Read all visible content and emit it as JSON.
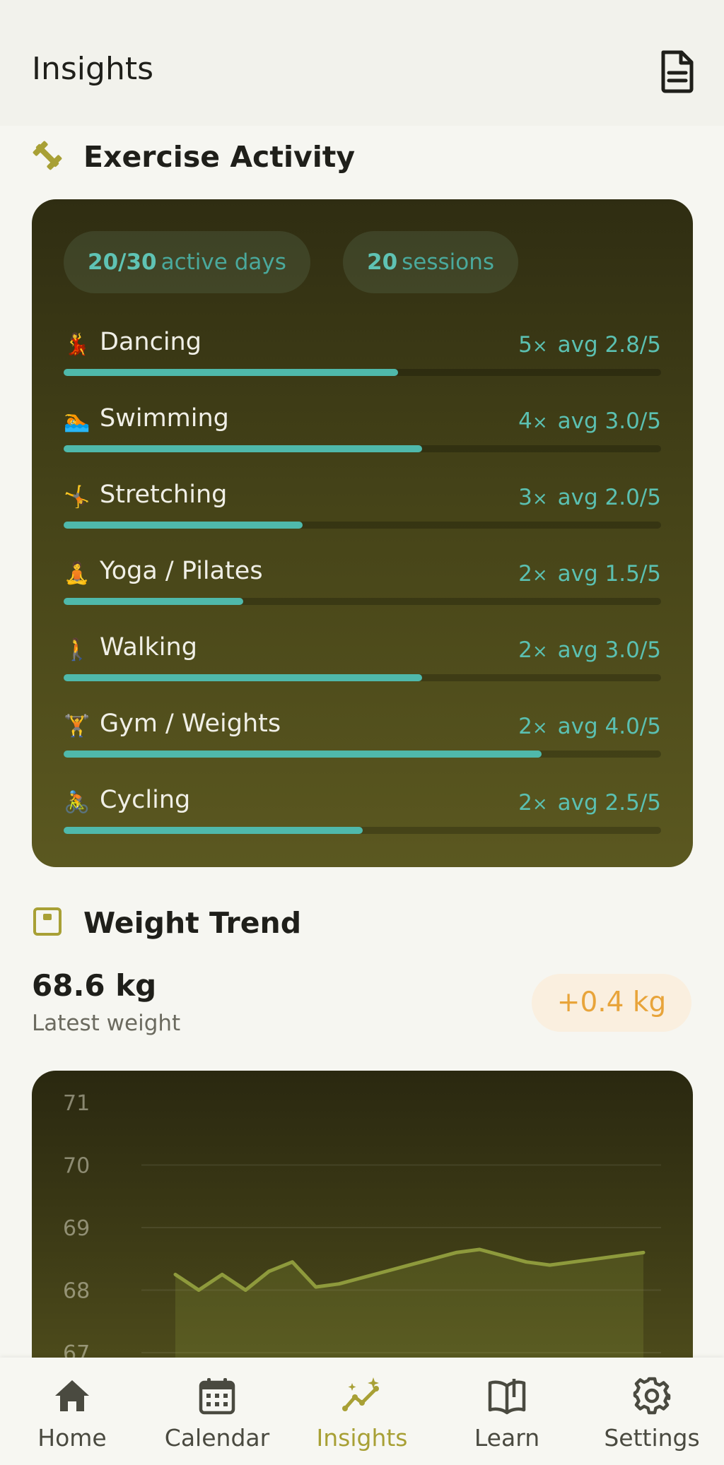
{
  "header": {
    "title": "Insights"
  },
  "exercise": {
    "title": "Exercise Activity",
    "active_days": "20/30",
    "active_days_unit": "active days",
    "sessions": "20",
    "sessions_unit": "sessions",
    "items": [
      {
        "emoji": "dancing",
        "name": "Dancing",
        "count": "5",
        "avg": "avg 2.8/5",
        "level": 0.56
      },
      {
        "emoji": "swimming",
        "name": "Swimming",
        "count": "4",
        "avg": "avg 3.0/5",
        "level": 0.6
      },
      {
        "emoji": "stretching",
        "name": "Stretching",
        "count": "3",
        "avg": "avg 2.0/5",
        "level": 0.4
      },
      {
        "emoji": "yoga",
        "name": "Yoga / Pilates",
        "count": "2",
        "avg": "avg 1.5/5",
        "level": 0.3
      },
      {
        "emoji": "walking",
        "name": "Walking",
        "count": "2",
        "avg": "avg 3.0/5",
        "level": 0.6
      },
      {
        "emoji": "gym",
        "name": "Gym / Weights",
        "count": "2",
        "avg": "avg 4.0/5",
        "level": 0.8
      },
      {
        "emoji": "cycling",
        "name": "Cycling",
        "count": "2",
        "avg": "avg 2.5/5",
        "level": 0.5
      }
    ],
    "count_suffix": "×"
  },
  "weight": {
    "title": "Weight Trend",
    "latest_value": "68.6 kg",
    "latest_label": "Latest weight",
    "delta": "+0.4 kg",
    "delta_color": "#e8a43a"
  },
  "chart_data": {
    "type": "line",
    "y_ticks": [
      "71",
      "70",
      "69",
      "68",
      "67"
    ],
    "ylim": [
      66.9,
      71
    ],
    "points": [
      68.25,
      68.0,
      68.25,
      68.0,
      68.3,
      68.45,
      68.05,
      68.1,
      68.2,
      68.3,
      68.4,
      68.5,
      68.6,
      68.65,
      68.55,
      68.45,
      68.4,
      68.45,
      68.5,
      68.55,
      68.6
    ],
    "line_color": "#8e9a3c"
  },
  "nav": {
    "items": [
      {
        "label": "Home",
        "icon": "home-icon"
      },
      {
        "label": "Calendar",
        "icon": "calendar-icon"
      },
      {
        "label": "Insights",
        "icon": "insights-icon",
        "active": true
      },
      {
        "label": "Learn",
        "icon": "book-icon"
      },
      {
        "label": "Settings",
        "icon": "gear-icon"
      }
    ]
  }
}
